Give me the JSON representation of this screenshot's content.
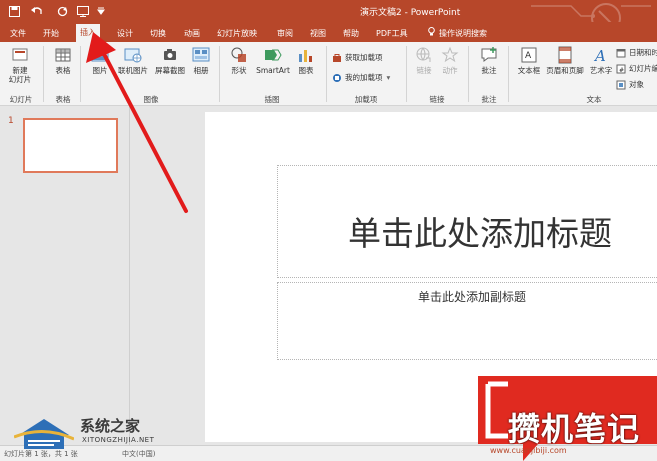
{
  "app": {
    "title": "演示文稿2  -  PowerPoint",
    "accent": "#b7472a"
  },
  "quick_access": [
    {
      "name": "save-icon",
      "glyph": "🖫"
    },
    {
      "name": "undo-icon",
      "glyph": "↶"
    },
    {
      "name": "redo-icon",
      "glyph": "↻"
    },
    {
      "name": "start-from-beginning-icon",
      "glyph": "⊞"
    },
    {
      "name": "customize-icon",
      "glyph": "▾"
    }
  ],
  "tabs": [
    "文件",
    "开始",
    "插入",
    "设计",
    "切换",
    "动画",
    "幻灯片放映",
    "审阅",
    "视图",
    "帮助",
    "PDF工具",
    "操作说明搜索"
  ],
  "active_tab": "插入",
  "ribbon": {
    "new_slide": "新建\n幻灯片",
    "table": "表格",
    "picture": "图片",
    "online_picture": "联机图片",
    "screenshot": "屏幕截图",
    "album": "相册",
    "shapes": "形状",
    "smartart": "SmartArt",
    "chart": "图表",
    "get_addins": "获取加载项",
    "my_addins": "我的加载项",
    "link": "链接",
    "action": "动作",
    "comment": "批注",
    "textbox": "文本框",
    "header_footer": "页眉和页脚",
    "wordart": "艺术字",
    "datetime": "日期和时",
    "slide_number": "幻灯片编",
    "object": "对象",
    "groups": {
      "slides": "幻灯片",
      "tables": "表格",
      "images": "图像",
      "illustrations": "插图",
      "addins": "加载项",
      "links": "链接",
      "comments": "批注",
      "text": "文本"
    }
  },
  "thumbnails": {
    "slide_number": "1"
  },
  "slide": {
    "title_placeholder": "单击此处添加标题",
    "subtitle_placeholder": "单击此处添加副标题"
  },
  "status": {
    "slide_info": "幻灯片第 1 张，共 1 张",
    "language": "中文(中国)"
  },
  "watermarks": {
    "left_brand": "系统之家",
    "left_url": "XITONGZHIJIA.NET",
    "right_brand": "攒机笔记",
    "right_url": "www.cuanjibiji.com"
  }
}
